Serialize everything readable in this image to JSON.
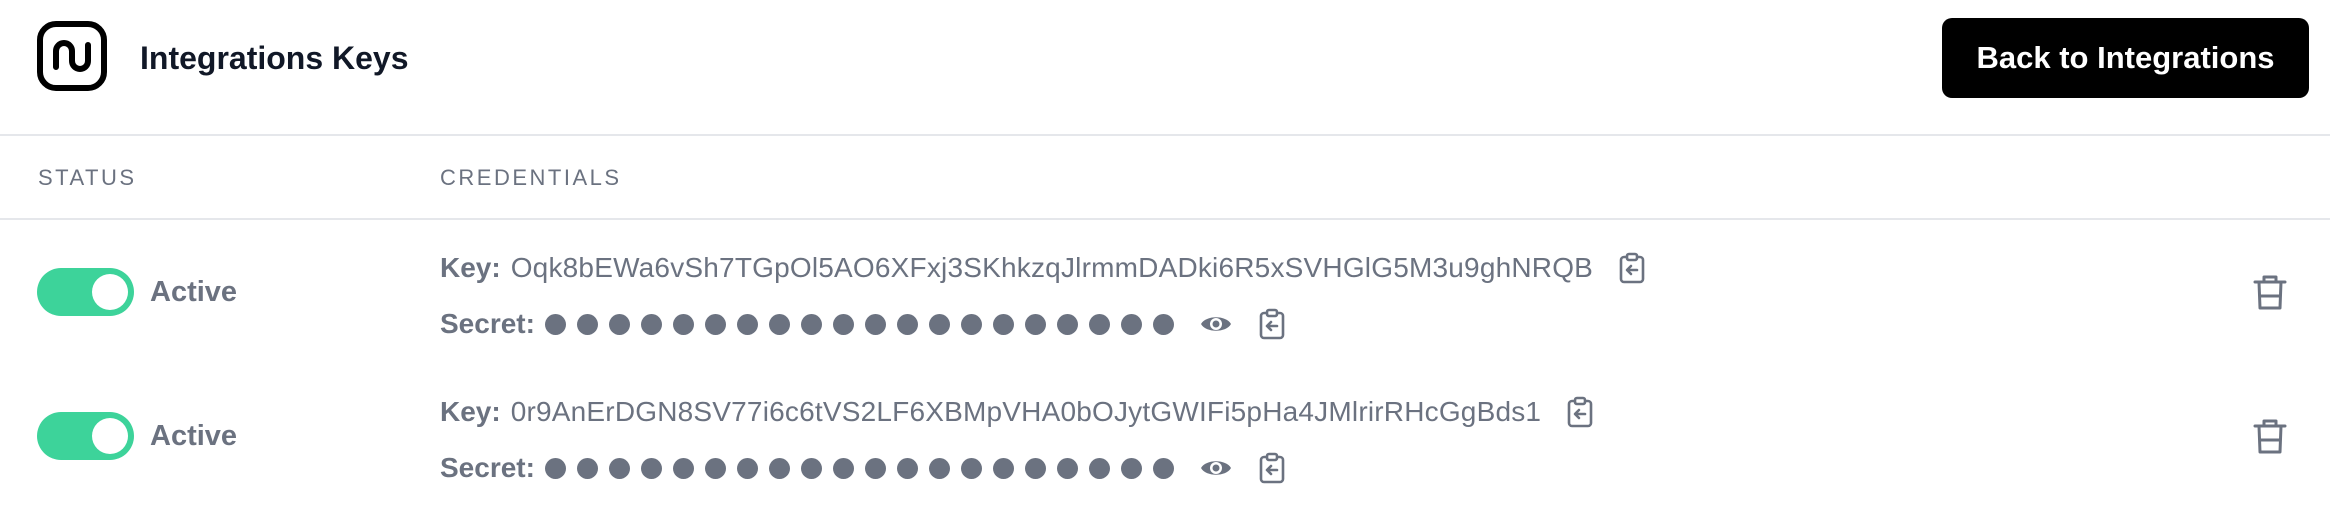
{
  "header": {
    "title": "Integrations Keys",
    "back_button_label": "Back to Integrations",
    "logo_icon": "wave-logo-icon"
  },
  "table": {
    "columns": {
      "status": "STATUS",
      "credentials": "CREDENTIALS"
    },
    "rows": [
      {
        "status_label": "Active",
        "enabled": true,
        "key_label": "Key:",
        "key_value": "Oqk8bEWa6vSh7TGpOl5AO6XFxj3SKhkzqJlrmmDADki6R5xSVHGlG5M3u9ghNRQB",
        "secret_label": "Secret:",
        "secret_masked_count": 20
      },
      {
        "status_label": "Active",
        "enabled": true,
        "key_label": "Key:",
        "key_value": "0r9AnErDGN8SV77i6c6tVS2LF6XBMpVHA0bOJytGWIFi5pHa4JMlrirRHcGgBds1",
        "secret_label": "Secret:",
        "secret_masked_count": 20
      }
    ]
  },
  "icons": {
    "copy": "clipboard-copy-icon",
    "reveal": "eye-icon",
    "delete": "trash-icon"
  },
  "colors": {
    "toggle_on": "#3dd39a",
    "muted_text": "#6b7280",
    "button_bg": "#000000",
    "divider": "#e5e7eb"
  }
}
